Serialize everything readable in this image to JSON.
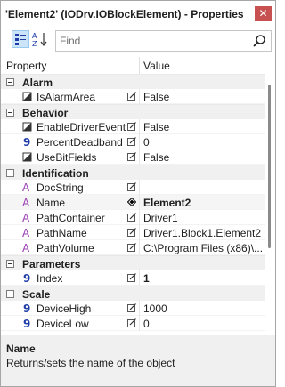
{
  "window": {
    "title": "'Element2' (IODrv.IOBlockElement) - Properties",
    "close_glyph": "✕"
  },
  "toolbar": {
    "categorized_icon": "categorized-view-icon",
    "alphabetical_icon": "sort-alphabetical-icon",
    "search_placeholder": "Find",
    "search_value": ""
  },
  "grid": {
    "header_property": "Property",
    "header_value": "Value",
    "categories": [
      {
        "label": "Alarm",
        "items": [
          {
            "type": "boolean",
            "name": "IsAlarmArea",
            "value": "False",
            "bold": false,
            "selected": false
          }
        ]
      },
      {
        "label": "Behavior",
        "items": [
          {
            "type": "boolean",
            "name": "EnableDriverEvent",
            "value": "False",
            "bold": false,
            "selected": false
          },
          {
            "type": "number",
            "name": "PercentDeadband",
            "value": "0",
            "bold": false,
            "selected": false
          },
          {
            "type": "boolean",
            "name": "UseBitFields",
            "value": "False",
            "bold": false,
            "selected": false
          }
        ]
      },
      {
        "label": "Identification",
        "items": [
          {
            "type": "string",
            "name": "DocString",
            "value": "",
            "bold": false,
            "selected": false
          },
          {
            "type": "string",
            "name": "Name",
            "value": "Element2",
            "bold": true,
            "selected": true
          },
          {
            "type": "string",
            "name": "PathContainer",
            "value": "Driver1",
            "bold": false,
            "selected": false
          },
          {
            "type": "string",
            "name": "PathName",
            "value": "Driver1.Block1.Element2",
            "bold": false,
            "selected": false
          },
          {
            "type": "string",
            "name": "PathVolume",
            "value": "C:\\Program Files (x86)\\...",
            "bold": false,
            "selected": false
          }
        ]
      },
      {
        "label": "Parameters",
        "items": [
          {
            "type": "number",
            "name": "Index",
            "value": "1",
            "bold": true,
            "selected": false
          }
        ]
      },
      {
        "label": "Scale",
        "items": [
          {
            "type": "number",
            "name": "DeviceHigh",
            "value": "1000",
            "bold": false,
            "selected": false
          },
          {
            "type": "number",
            "name": "DeviceLow",
            "value": "0",
            "bold": false,
            "selected": false
          }
        ]
      }
    ]
  },
  "description": {
    "title": "Name",
    "text": "Returns/sets the name of the object"
  },
  "colors": {
    "string_icon": "#9b3fb4",
    "number_icon": "#1e3ca8",
    "close_bg": "#c75050"
  }
}
